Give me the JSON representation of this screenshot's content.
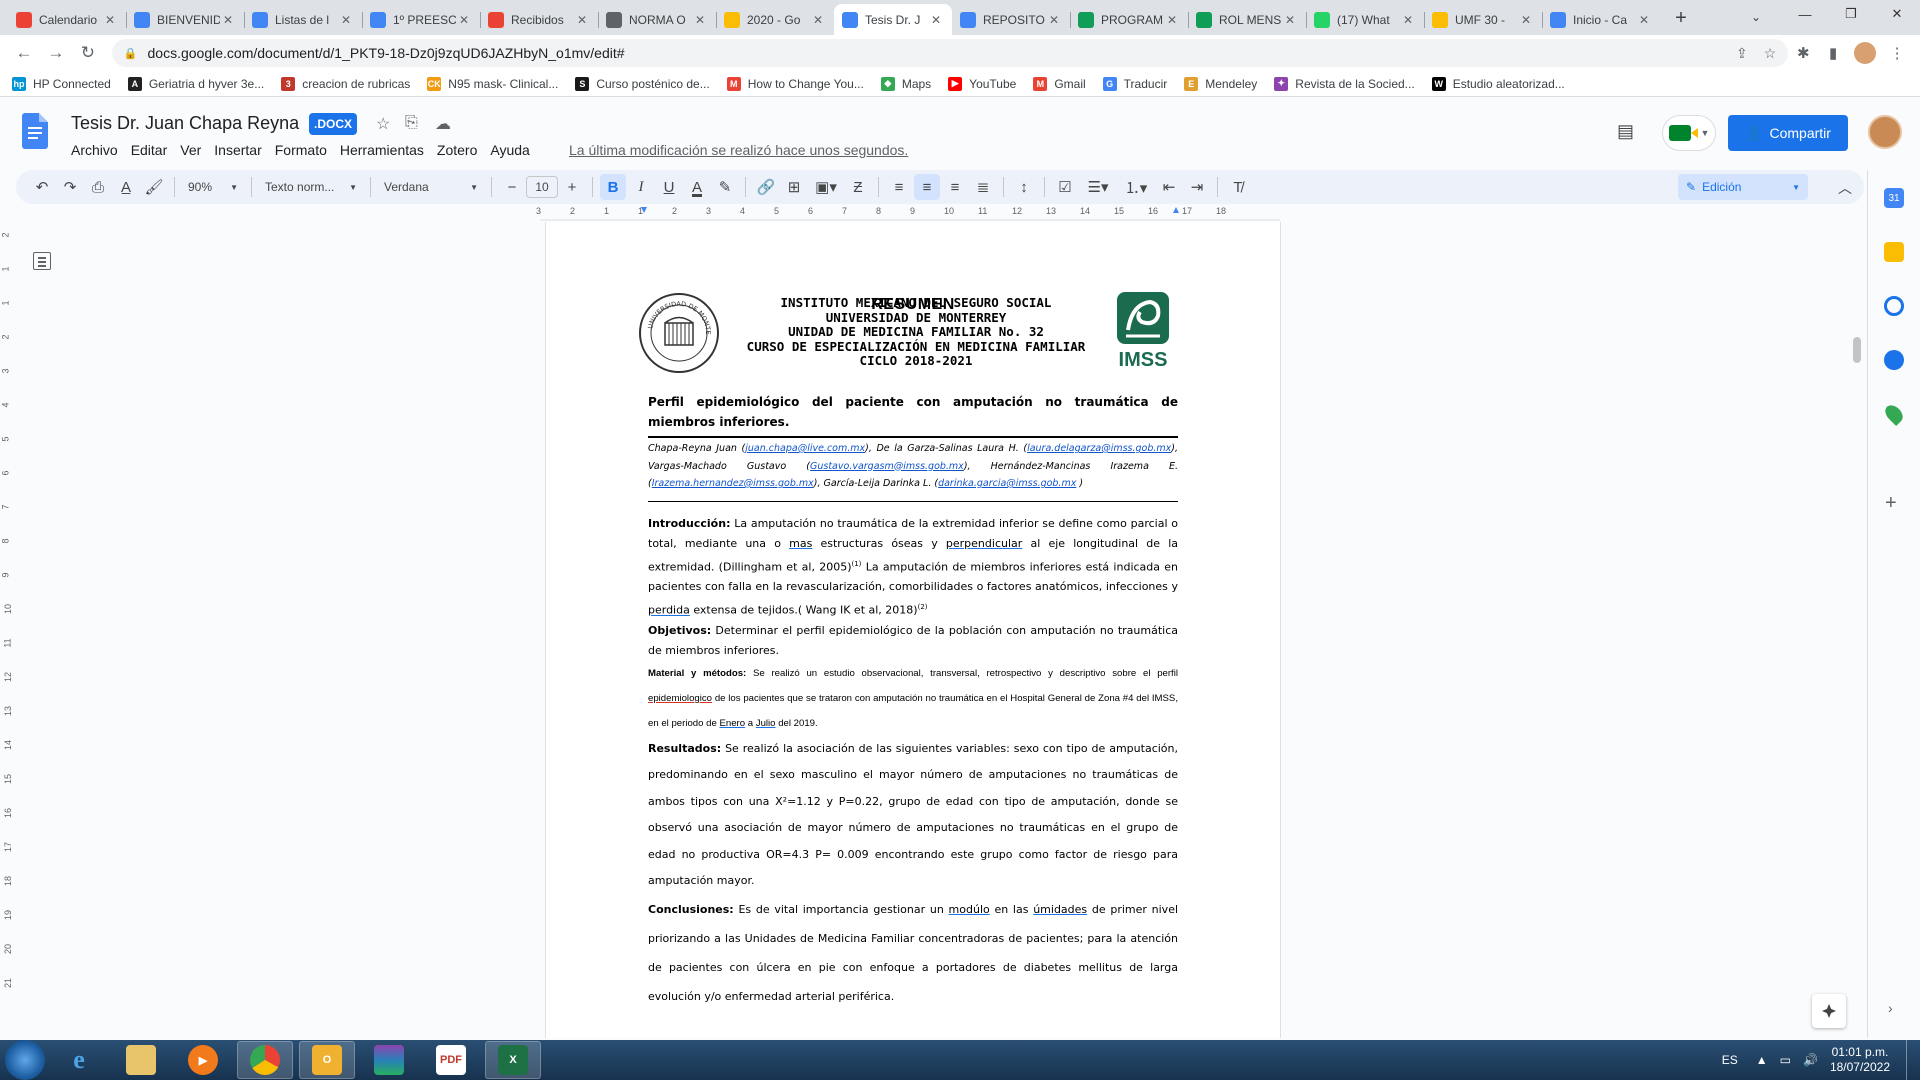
{
  "browser": {
    "tabs": [
      {
        "title": "Calendario",
        "icon": "gmail-icon",
        "color": "#ea4335"
      },
      {
        "title": "BIENVENID",
        "icon": "docs-icon",
        "color": "#4285f4"
      },
      {
        "title": "Listas de l",
        "icon": "docs-icon",
        "color": "#4285f4"
      },
      {
        "title": "1º PREESC",
        "icon": "docs-icon",
        "color": "#4285f4"
      },
      {
        "title": "Recibidos",
        "icon": "gmail-icon",
        "color": "#ea4335"
      },
      {
        "title": "NORMA O",
        "icon": "globe-icon",
        "color": "#5f6368"
      },
      {
        "title": "2020 - Go",
        "icon": "drive-icon",
        "color": "#fbbc04"
      },
      {
        "title": "Tesis Dr. J",
        "icon": "docs-icon",
        "color": "#4285f4",
        "active": true
      },
      {
        "title": "REPOSITO",
        "icon": "chrome-icon",
        "color": "#4285f4"
      },
      {
        "title": "PROGRAM",
        "icon": "sheets-icon",
        "color": "#0f9d58"
      },
      {
        "title": "ROL MENS",
        "icon": "sheets-icon",
        "color": "#0f9d58"
      },
      {
        "title": "(17) What",
        "icon": "whatsapp-icon",
        "color": "#25d366"
      },
      {
        "title": "UMF 30 -",
        "icon": "drive-icon",
        "color": "#fbbc04"
      },
      {
        "title": "Inicio - Ca",
        "icon": "chrome-icon",
        "color": "#4285f4"
      }
    ],
    "url": "docs.google.com/document/d/1_PKT9-18-Dz0j9zqUD6JAZHbyN_o1mv/edit#",
    "bookmarks": [
      {
        "label": "HP Connected",
        "color": "#0096d6",
        "glyph": "hp"
      },
      {
        "label": "Geriatria d hyver 3e...",
        "color": "#222222",
        "glyph": "A"
      },
      {
        "label": "creacion de rubricas",
        "color": "#c0392b",
        "glyph": "3"
      },
      {
        "label": "N95 mask- Clinical...",
        "color": "#f39c12",
        "glyph": "CK"
      },
      {
        "label": "Curso posténico de...",
        "color": "#1a1a1a",
        "glyph": "S"
      },
      {
        "label": "How to Change You...",
        "color": "#ea4335",
        "glyph": "M"
      },
      {
        "label": "Maps",
        "color": "#34a853",
        "glyph": "◆"
      },
      {
        "label": "YouTube",
        "color": "#ff0000",
        "glyph": "▶"
      },
      {
        "label": "Gmail",
        "color": "#ea4335",
        "glyph": "M"
      },
      {
        "label": "Traducir",
        "color": "#4285f4",
        "glyph": "G"
      },
      {
        "label": "Mendeley",
        "color": "#e0a030",
        "glyph": "E"
      },
      {
        "label": "Revista de la Socied...",
        "color": "#8e44ad",
        "glyph": "✦"
      },
      {
        "label": "Estudio aleatorizad...",
        "color": "#000000",
        "glyph": "W"
      }
    ]
  },
  "docs": {
    "title": "Tesis Dr. Juan Chapa Reyna",
    "badge": ".DOCX",
    "menu": [
      "Archivo",
      "Editar",
      "Ver",
      "Insertar",
      "Formato",
      "Herramientas",
      "Zotero",
      "Ayuda"
    ],
    "last_edit": "La última modificación se realizó hace unos segundos.",
    "share_label": "Compartir",
    "toolbar": {
      "zoom": "90%",
      "style": "Texto norm...",
      "font": "Verdana",
      "font_size": "10",
      "mode": "Edición"
    },
    "ruler_labels": [
      "3",
      "2",
      "1",
      "1",
      "2",
      "3",
      "4",
      "5",
      "6",
      "7",
      "8",
      "9",
      "10",
      "11",
      "12",
      "13",
      "14",
      "15",
      "16",
      "17",
      "18"
    ],
    "vruler_labels": [
      "2",
      "1",
      "1",
      "2",
      "3",
      "4",
      "5",
      "6",
      "7",
      "8",
      "9",
      "10",
      "11",
      "12",
      "13",
      "14",
      "15",
      "16",
      "17",
      "18",
      "19",
      "20",
      "21"
    ]
  },
  "document": {
    "heading": "RESUMEN",
    "institution_lines": [
      "INSTITUTO MEXICANO DEL SEGURO SOCIAL",
      "UNIVERSIDAD DE MONTERREY",
      "UNIDAD DE MEDICINA FAMILIAR No. 32",
      "CURSO DE ESPECIALIZACIÓN EN MEDICINA FAMILIAR",
      "CICLO 2018-2021"
    ],
    "imss_logo_text": "IMSS",
    "seal_text": "UNIVERSIDAD DE MONTERREY",
    "article_title": "Perfil epidemiológico del paciente con amputación no traumática de miembros inferiores.",
    "authors": {
      "a1_name": "Chapa-Reyna Juan",
      "a1_email": "juan.chapa@live.com.mx",
      "a2_name": "De la Garza-Salinas Laura H.",
      "a2_email": "laura.delagarza@imss.gob.mx",
      "a3_name": "Vargas-Machado Gustavo",
      "a3_email": "Gustavo.vargasm@imss.gob.mx",
      "a4_name": "Hernández-Mancinas Irazema E.",
      "a4_email": "Irazema.hernandez@imss.gob.mx",
      "a5_name": "García-Leija Darinka L.",
      "a5_email": "darinka.garcia@imss.gob.mx"
    },
    "intro_label": "Introducción:",
    "intro_text_1": "La amputación no traumática de la extremidad inferior se define como parcial o total, mediante una o",
    "intro_mas": "mas",
    "intro_text_2": "estructuras óseas y",
    "intro_perpendicular": "perpendicular",
    "intro_text_3": "al eje longitudinal de la extremidad. (Dillingham et al, 2005)",
    "intro_ref1": "(1)",
    "intro_text_4": "La amputación de miembros inferiores está indicada en pacientes con falla en la revascularización, comorbilidades o factores anatómicos, infecciones y",
    "intro_perdida": "perdida",
    "intro_text_5": "extensa de tejidos.( Wang IK et al, 2018)",
    "intro_ref2": "(2)",
    "obj_label": "Objetivos:",
    "obj_text": "Determinar el perfil  epidemiológico de la población con amputación no traumática de miembros inferiores.",
    "mat_label": "Material y métodos:",
    "mat_text_1": "Se realizó un estudio observacional, transversal, retrospectivo y descriptivo sobre el perfil",
    "mat_epid": "epidemiologico",
    "mat_text_2": "de los pacientes que se trataron con amputación no traumática en el Hospital General de Zona #4 del IMSS, en el periodo de",
    "mat_enero": "Enero",
    "mat_a": "a",
    "mat_julio": "Julio",
    "mat_text_3": "del 2019.",
    "res_label": "Resultados:",
    "res_text": "Se realizó la asociación de las siguientes variables: sexo con tipo de amputación, predominando en el sexo masculino el mayor número de amputaciones no traumáticas de ambos tipos con una X²=1.12 y P=0.22, grupo de edad con tipo de amputación, donde se observó una asociación de mayor número de amputaciones no traumáticas en el grupo de edad no productiva OR=4.3 P= 0.009 encontrando este grupo como factor de riesgo para amputación mayor.",
    "conc_label": "Conclusiones:",
    "conc_text_1": "Es de vital importancia gestionar un",
    "conc_modulo": "modúlo",
    "conc_text_2": "en las",
    "conc_unidades": "úmidades",
    "conc_text_3": "de primer nivel priorizando a las Unidades de Medicina Familiar concentradoras de pacientes; para la atención de pacientes con úlcera en pie con enfoque a portadores de  diabetes mellitus de larga evolución y/o enfermedad arterial periférica."
  },
  "taskbar": {
    "language": "ES",
    "time": "01:01 p.m.",
    "date": "18/07/2022"
  }
}
